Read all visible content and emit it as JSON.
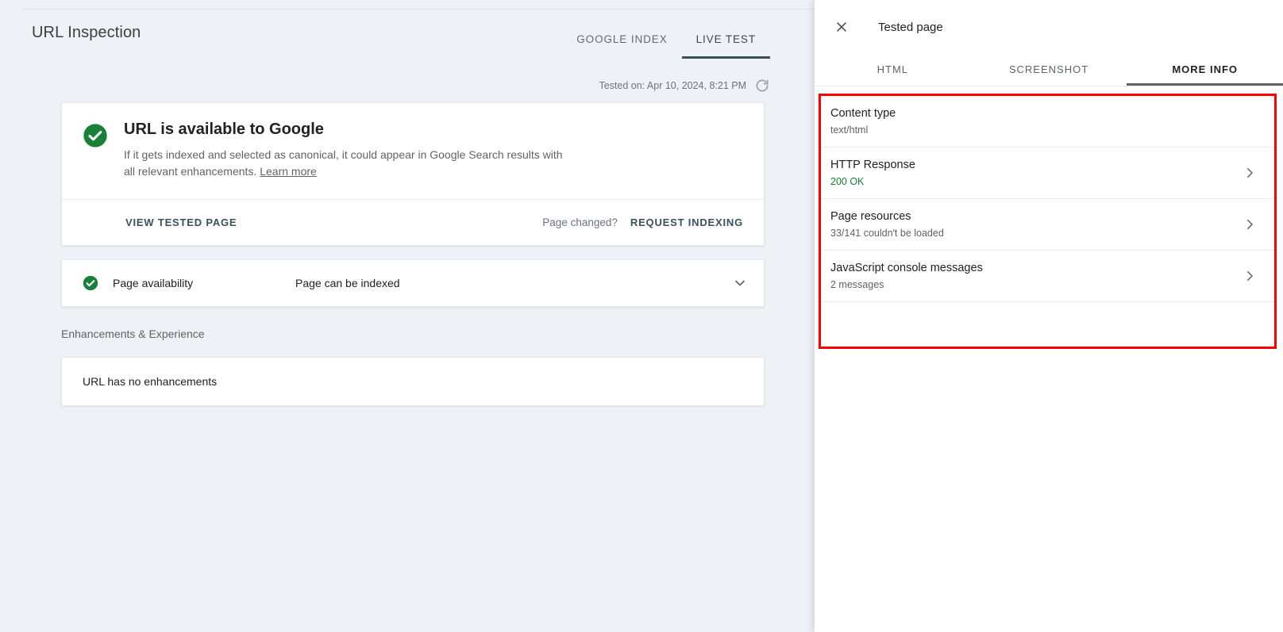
{
  "main": {
    "page_title": "URL Inspection",
    "tabs": [
      {
        "label": "GOOGLE INDEX",
        "active": false
      },
      {
        "label": "LIVE TEST",
        "active": true
      }
    ],
    "tested_on": "Tested on: Apr 10, 2024, 8:21 PM",
    "refresh_icon": "refresh-icon",
    "result": {
      "status_icon": "check-circle-icon",
      "title": "URL is available to Google",
      "description": "If it gets indexed and selected as canonical, it could appear in Google Search results with all relevant enhancements.",
      "learn_more": "Learn more",
      "view_tested_page": "VIEW TESTED PAGE",
      "page_changed": "Page changed?",
      "request_indexing": "REQUEST INDEXING"
    },
    "availability": {
      "status_icon": "check-circle-icon",
      "label": "Page availability",
      "value": "Page can be indexed",
      "expand_icon": "chevron-down-icon"
    },
    "section_label": "Enhancements & Experience",
    "enhancements_text": "URL has no enhancements"
  },
  "side_panel": {
    "close_icon": "close-icon",
    "title": "Tested page",
    "tabs": [
      {
        "label": "HTML",
        "active": false
      },
      {
        "label": "SCREENSHOT",
        "active": false
      },
      {
        "label": "MORE INFO",
        "active": true
      }
    ],
    "highlight_color": "#ff0000",
    "rows": [
      {
        "title": "Content type",
        "sub": "text/html",
        "sub_style": "muted",
        "chevron": false
      },
      {
        "title": "HTTP Response",
        "sub": "200 OK",
        "sub_style": "ok",
        "chevron": true
      },
      {
        "title": "Page resources",
        "sub": "33/141 couldn't be loaded",
        "sub_style": "muted",
        "chevron": true
      },
      {
        "title": "JavaScript console messages",
        "sub": "2 messages",
        "sub_style": "muted",
        "chevron": true
      }
    ]
  },
  "colors": {
    "background": "#eef1f6",
    "accent_tab": "#3c5059",
    "success_green": "#188038",
    "highlight_red": "#ff0000"
  }
}
